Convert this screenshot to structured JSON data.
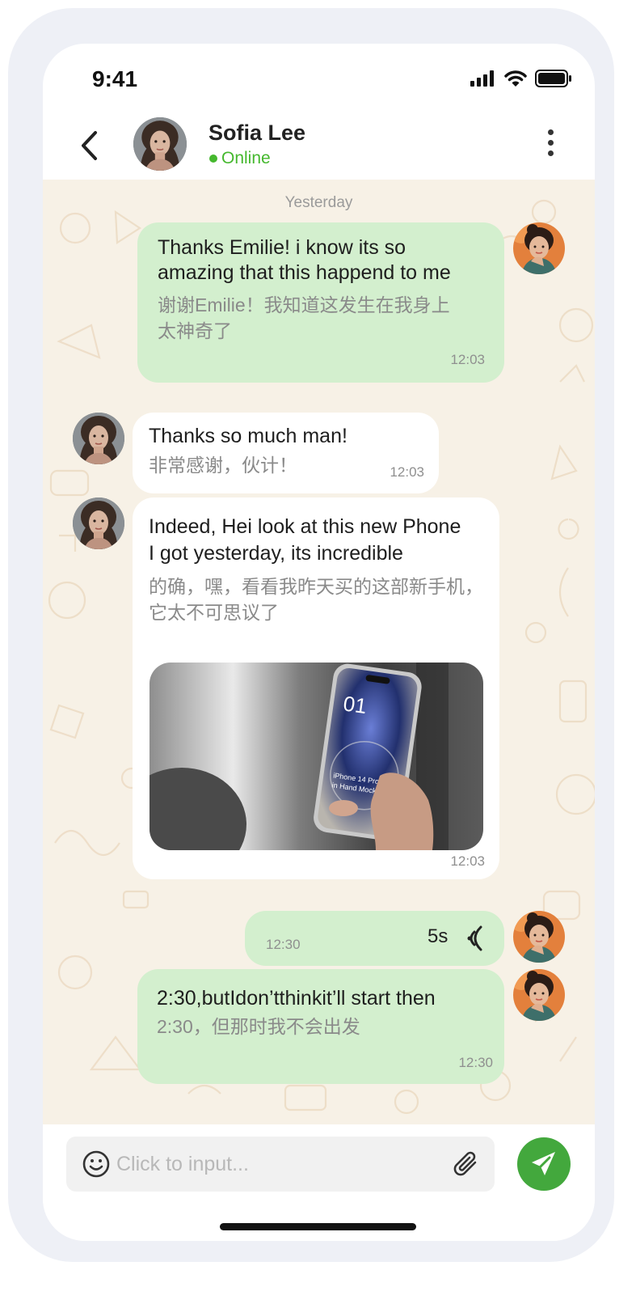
{
  "status_bar": {
    "time": "9:41"
  },
  "header": {
    "contact_name": "Sofia Lee",
    "contact_status": "Online"
  },
  "chat": {
    "day_separator": "Yesterday",
    "messages": [
      {
        "direction": "out",
        "text": "Thanks Emilie! i know its so amazing that this happend to me",
        "translation": "谢谢Emilie！我知道这发生在我身上太神奇了",
        "time": "12:03"
      },
      {
        "direction": "in",
        "text": "Thanks so much man!",
        "translation": "非常感谢，伙计！",
        "time": "12:03"
      },
      {
        "direction": "in",
        "text": "Indeed, Hei look at this new Phone I got yesterday, its incredible",
        "translation": "的确，嘿，看看我昨天买的这部新手机，它太不可思议了",
        "time": "12:03",
        "image": {
          "screen_number": "01",
          "caption_line1": "iPhone 14 Pro",
          "caption_line2": "in Hand Mockup"
        }
      },
      {
        "direction": "out",
        "type": "voice",
        "duration": "5s",
        "time": "12:30"
      },
      {
        "direction": "out",
        "text": "2:30,butIdon’tthinkit’ll start then",
        "translation": "2:30，但那时我不会出发",
        "time": "12:30"
      }
    ]
  },
  "input": {
    "placeholder": "Click to input..."
  },
  "colors": {
    "accent": "#43a83d",
    "online": "#45b82e",
    "outgoing_bubble": "#d3efce",
    "chat_background": "#f7f1e6"
  },
  "icons": {
    "back": "chevron-left-icon",
    "menu": "more-vertical-icon",
    "emoji": "smiley-icon",
    "attach": "paperclip-icon",
    "send": "send-icon",
    "voice": "sound-wave-icon"
  }
}
